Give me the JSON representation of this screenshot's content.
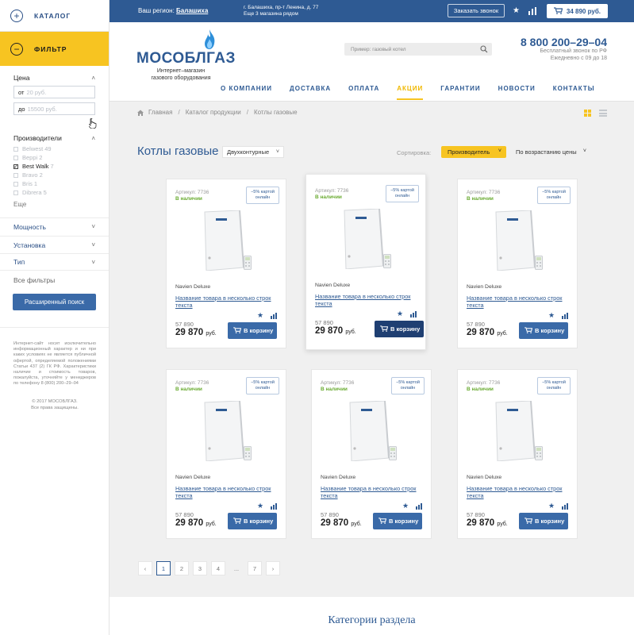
{
  "sidebar": {
    "catalog_label": "КАТАЛОГ",
    "filter_label": "ФИЛЬТР",
    "price_title": "Цена",
    "price_from_prefix": "от",
    "price_from_placeholder": "20 руб.",
    "price_to_prefix": "до",
    "price_to_placeholder": "15500 руб.",
    "manufacturers_title": "Производители",
    "manufacturers": [
      {
        "name": "Belwest",
        "count": "49",
        "checked": false
      },
      {
        "name": "Beppi",
        "count": "2",
        "checked": false
      },
      {
        "name": "Best Walk",
        "count": "7",
        "checked": true
      },
      {
        "name": "Bravo",
        "count": "2",
        "checked": false
      },
      {
        "name": "Bris",
        "count": "1",
        "checked": false
      },
      {
        "name": "Dibrera",
        "count": "5",
        "checked": false
      }
    ],
    "more_label": "Еще",
    "sections": [
      "Мощность",
      "Установка",
      "Тип"
    ],
    "all_filters": "Все фильтры",
    "advanced_search": "Расширенный поиск",
    "legal": "Интернет-сайт носит исключительно информационный характер и ни при каких условиях не является публичной офертой, определяемой положениями Статьи 437 (2) ГК РФ. Характеристики наличие и стоимость товаров, пожалуйста, уточняйте у менеджеров по телефону 8 (800) 200–29–04",
    "copyright_line1": "© 2017 МОСОБЛГАЗ.",
    "copyright_line2": "Все права защищены."
  },
  "topbar": {
    "region_label": "Ваш регион:",
    "region_value": "Балашиха",
    "address_line1": "г. Балашиха, пр-т Ленина, д. 77",
    "address_line2": "Еще 3 магазина рядом",
    "call_button": "Заказать звонок",
    "cart_total": "34 890 руб."
  },
  "header": {
    "logo_text": "МОСОБЛГАЗ",
    "tagline_line1": "Интернет–магазин",
    "tagline_line2": "газового оборудования",
    "search_placeholder": "Пример: газовый котел",
    "phone": "8 800 200–29–04",
    "phone_sub1": "Бесплатный звонок по РФ",
    "phone_sub2": "Ежедневно с 09 до 18",
    "nav": [
      "О КОМПАНИИ",
      "ДОСТАВКА",
      "ОПЛАТА",
      "АКЦИИ",
      "ГАРАНТИИ",
      "НОВОСТИ",
      "КОНТАКТЫ"
    ],
    "nav_active": "АКЦИИ"
  },
  "breadcrumbs": [
    "Главная",
    "Каталог продукции",
    "Котлы газовые"
  ],
  "listing": {
    "title": "Котлы газовые",
    "type_filter": "Двухконтурные",
    "sort_label": "Сортировка:",
    "sort_by": "Производитель",
    "sort_order": "По возрастанию цены"
  },
  "products": [
    {
      "sku": "Артикул: 7736",
      "stock": "В наличии",
      "promo": "−5% картой онлайн",
      "brand": "Navien Deluxe",
      "name": "Название товара в несколько строк текста",
      "old_price": "57 890",
      "price": "29 870",
      "currency": "руб.",
      "buy": "В корзину"
    },
    {
      "sku": "Артикул: 7736",
      "stock": "В наличии",
      "promo": "−5% картой онлайн",
      "brand": "Navien Deluxe",
      "name": "Название товара в несколько строк текста",
      "old_price": "57 890",
      "price": "29 870",
      "currency": "руб.",
      "buy": "В корзину"
    },
    {
      "sku": "Артикул: 7736",
      "stock": "В наличии",
      "promo": "−5% картой онлайн",
      "brand": "Navien Deluxe",
      "name": "Название товара в несколько строк текста",
      "old_price": "57 890",
      "price": "29 870",
      "currency": "руб.",
      "buy": "В корзину"
    },
    {
      "sku": "Артикул: 7736",
      "stock": "В наличии",
      "promo": "−5% картой онлайн",
      "brand": "Navien Deluxe",
      "name": "Название товара в несколько строк текста",
      "old_price": "57 890",
      "price": "29 870",
      "currency": "руб.",
      "buy": "В корзину"
    },
    {
      "sku": "Артикул: 7736",
      "stock": "В наличии",
      "promo": "−5% картой онлайн",
      "brand": "Navien Deluxe",
      "name": "Название товара в несколько строк текста",
      "old_price": "57 890",
      "price": "29 870",
      "currency": "руб.",
      "buy": "В корзину"
    },
    {
      "sku": "Артикул: 7736",
      "stock": "В наличии",
      "promo": "−5% картой онлайн",
      "brand": "Navien Deluxe",
      "name": "Название товара в несколько строк текста",
      "old_price": "57 890",
      "price": "29 870",
      "currency": "руб.",
      "buy": "В корзину"
    }
  ],
  "pagination": {
    "prev": "‹",
    "pages": [
      "1",
      "2",
      "3",
      "4",
      "...",
      "7"
    ],
    "next": "›",
    "current": "1"
  },
  "categories_title": "Категории раздела",
  "icons": {
    "catalog": "plus-circle-icon",
    "filter": "minus-circle-icon",
    "search": "search-icon",
    "favorites": "star-icon",
    "compare": "bar-chart-icon",
    "cart": "cart-icon",
    "home": "home-icon"
  },
  "colors": {
    "brand_blue": "#2e5a93",
    "accent_yellow": "#f7c421",
    "in_stock_green": "#6aab32",
    "button_blue": "#3a6aa8"
  }
}
